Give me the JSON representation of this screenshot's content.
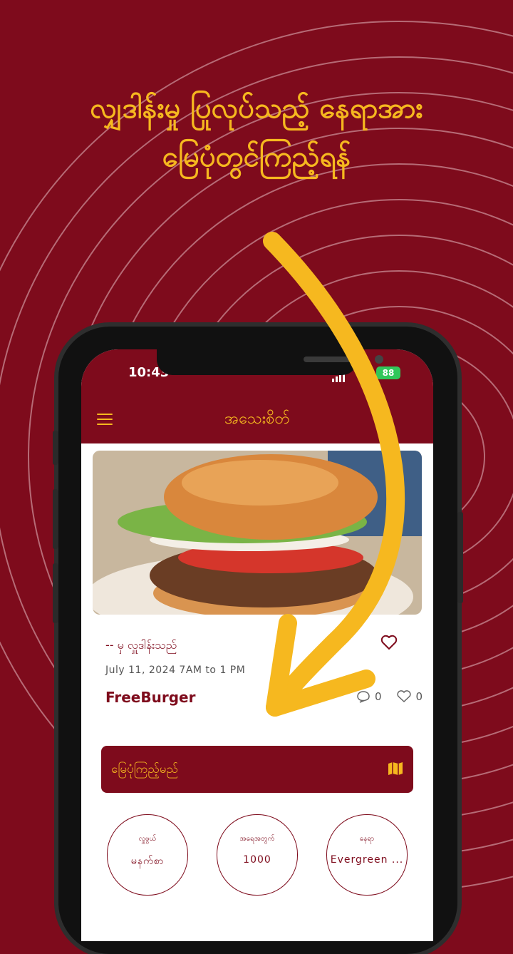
{
  "headline": {
    "line1": "လျှဒါန်းမှု ပြုလုပ်သည့် နေရာအား",
    "line2": "မြေပုံတွင်ကြည့်ရန်"
  },
  "status_bar": {
    "time": "10:43",
    "battery": "88"
  },
  "app_bar": {
    "title": "အသေးစိတ်",
    "menu_icon": "hamburger-menu-icon"
  },
  "post": {
    "posted_by": "-- မှ လှူဒါန်းသည်",
    "date": "July 11, 2024 7AM to 1 PM",
    "title": "FreeBurger",
    "comments": "0",
    "likes": "0",
    "image": "burger-photo"
  },
  "map_button": {
    "label": "မြေပုံကြည့်မည်",
    "icon": "map-icon"
  },
  "info_circles": [
    {
      "label": "လှူဖွယ်",
      "value": "မနက်စာ"
    },
    {
      "label": "အရေအတွက်",
      "value": "1000"
    },
    {
      "label": "နေရာ",
      "value": "Evergreen ..."
    }
  ],
  "colors": {
    "brand": "#7e0b1c",
    "accent": "#f6b81f"
  }
}
